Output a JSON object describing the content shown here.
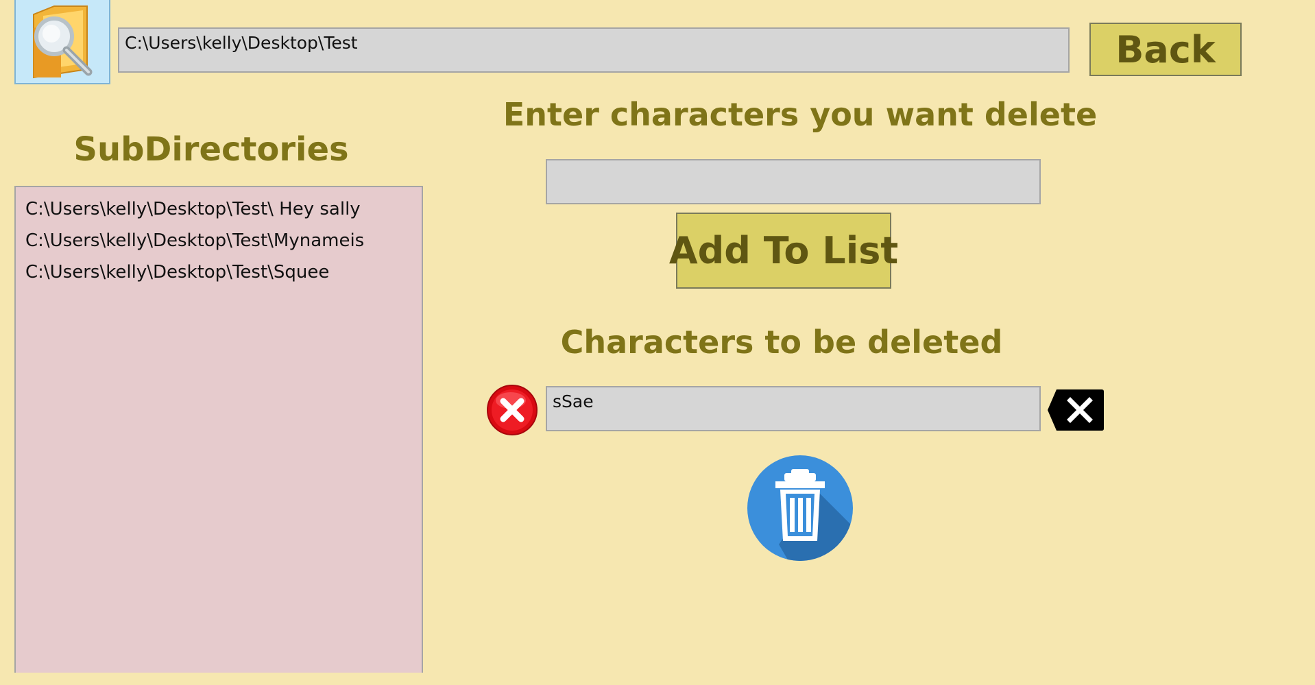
{
  "header": {
    "browse_icon": "folder-search-icon",
    "path": "C:\\Users\\kelly\\Desktop\\Test",
    "back_label": "Back"
  },
  "subdirectories": {
    "title": "SubDirectories",
    "items": [
      "C:\\Users\\kelly\\Desktop\\Test\\ Hey sally",
      "C:\\Users\\kelly\\Desktop\\Test\\Mynameis",
      "C:\\Users\\kelly\\Desktop\\Test\\Squee"
    ]
  },
  "entry": {
    "title": "Enter characters you want delete",
    "input_value": "",
    "add_label": "Add To List"
  },
  "delete_list": {
    "title": "Characters to be deleted",
    "value": "sSae",
    "remove_icon": "remove-red-x-icon",
    "backspace_icon": "backspace-icon",
    "trash_icon": "trash-icon"
  },
  "colors": {
    "background": "#f6e7b0",
    "heading": "#7f7418",
    "button": "#dbd066",
    "list_bg": "#e6cbcd",
    "field_bg": "#d6d6d6",
    "trash_blue": "#3b8fdb"
  }
}
